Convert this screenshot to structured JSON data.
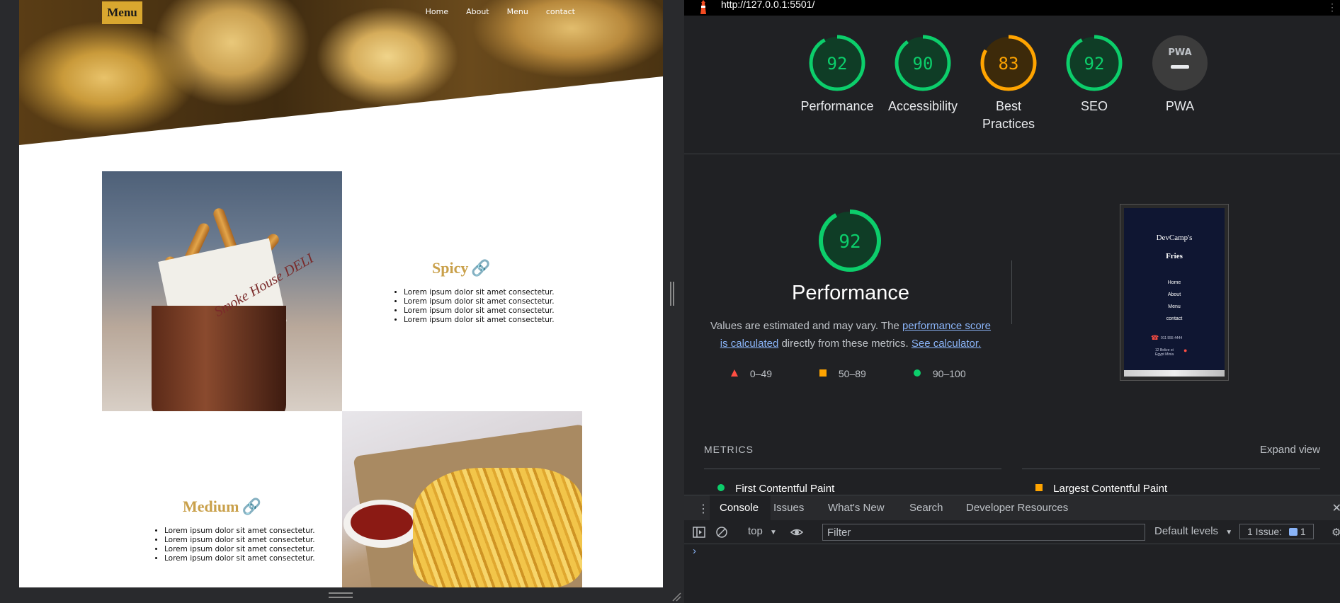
{
  "site": {
    "brand": "Menu",
    "nav": [
      "Home",
      "About",
      "Menu",
      "contact"
    ],
    "sections": [
      {
        "title": "Spicy",
        "bullets": [
          "Lorem ipsum dolor sit amet consectetur.",
          "Lorem ipsum dolor sit amet consectetur.",
          "Lorem ipsum dolor sit amet consectetur.",
          "Lorem ipsum dolor sit amet consectetur."
        ]
      },
      {
        "title": "Medium",
        "bullets": [
          "Lorem ipsum dolor sit amet consectetur.",
          "Lorem ipsum dolor sit amet consectetur.",
          "Lorem ipsum dolor sit amet consectetur.",
          "Lorem ipsum dolor sit amet consectetur."
        ]
      }
    ],
    "photo1_text": "Smoke House DELI",
    "accent": "#c9a04a",
    "brand_bg": "#d9a72f"
  },
  "devtools": {
    "url": "http://127.0.0.1:5501/",
    "scores": [
      {
        "label": "Performance",
        "value": "92",
        "color": "#0cce6b",
        "fraction": 0.92
      },
      {
        "label": "Accessibility",
        "value": "90",
        "color": "#0cce6b",
        "fraction": 0.9
      },
      {
        "label": "Best Practices",
        "value": "83",
        "color": "#ffa400",
        "fraction": 0.83
      },
      {
        "label": "SEO",
        "value": "92",
        "color": "#0cce6b",
        "fraction": 0.92
      },
      {
        "label": "PWA",
        "value": "PWA",
        "color": "#9aa0a6",
        "fraction": 0
      }
    ],
    "performance": {
      "score": "92",
      "title": "Performance",
      "desc_pre": "Values are estimated and may vary. The ",
      "link1": "performance score is calculated",
      "desc_mid": " directly from these metrics. ",
      "link2": "See calculator.",
      "legend": [
        "0–49",
        "50–89",
        "90–100"
      ]
    },
    "thumbnail": {
      "title_line1": "DevCamp's",
      "title_line2": "Fries",
      "nav": [
        "Home",
        "About",
        "Menu",
        "contact"
      ],
      "phone": "011 555 4444",
      "address": "12 Belize st Egypt Minia"
    },
    "metrics": {
      "heading": "METRICS",
      "expand": "Expand view",
      "items": [
        "First Contentful Paint",
        "Largest Contentful Paint"
      ]
    },
    "drawer": {
      "tabs": [
        "Console",
        "Issues",
        "What's New",
        "Search",
        "Developer Resources"
      ],
      "context": "top",
      "filter_placeholder": "Filter",
      "levels": "Default levels",
      "issues_label": "1 Issue:",
      "issues_count": "1",
      "prompt": "›"
    }
  }
}
